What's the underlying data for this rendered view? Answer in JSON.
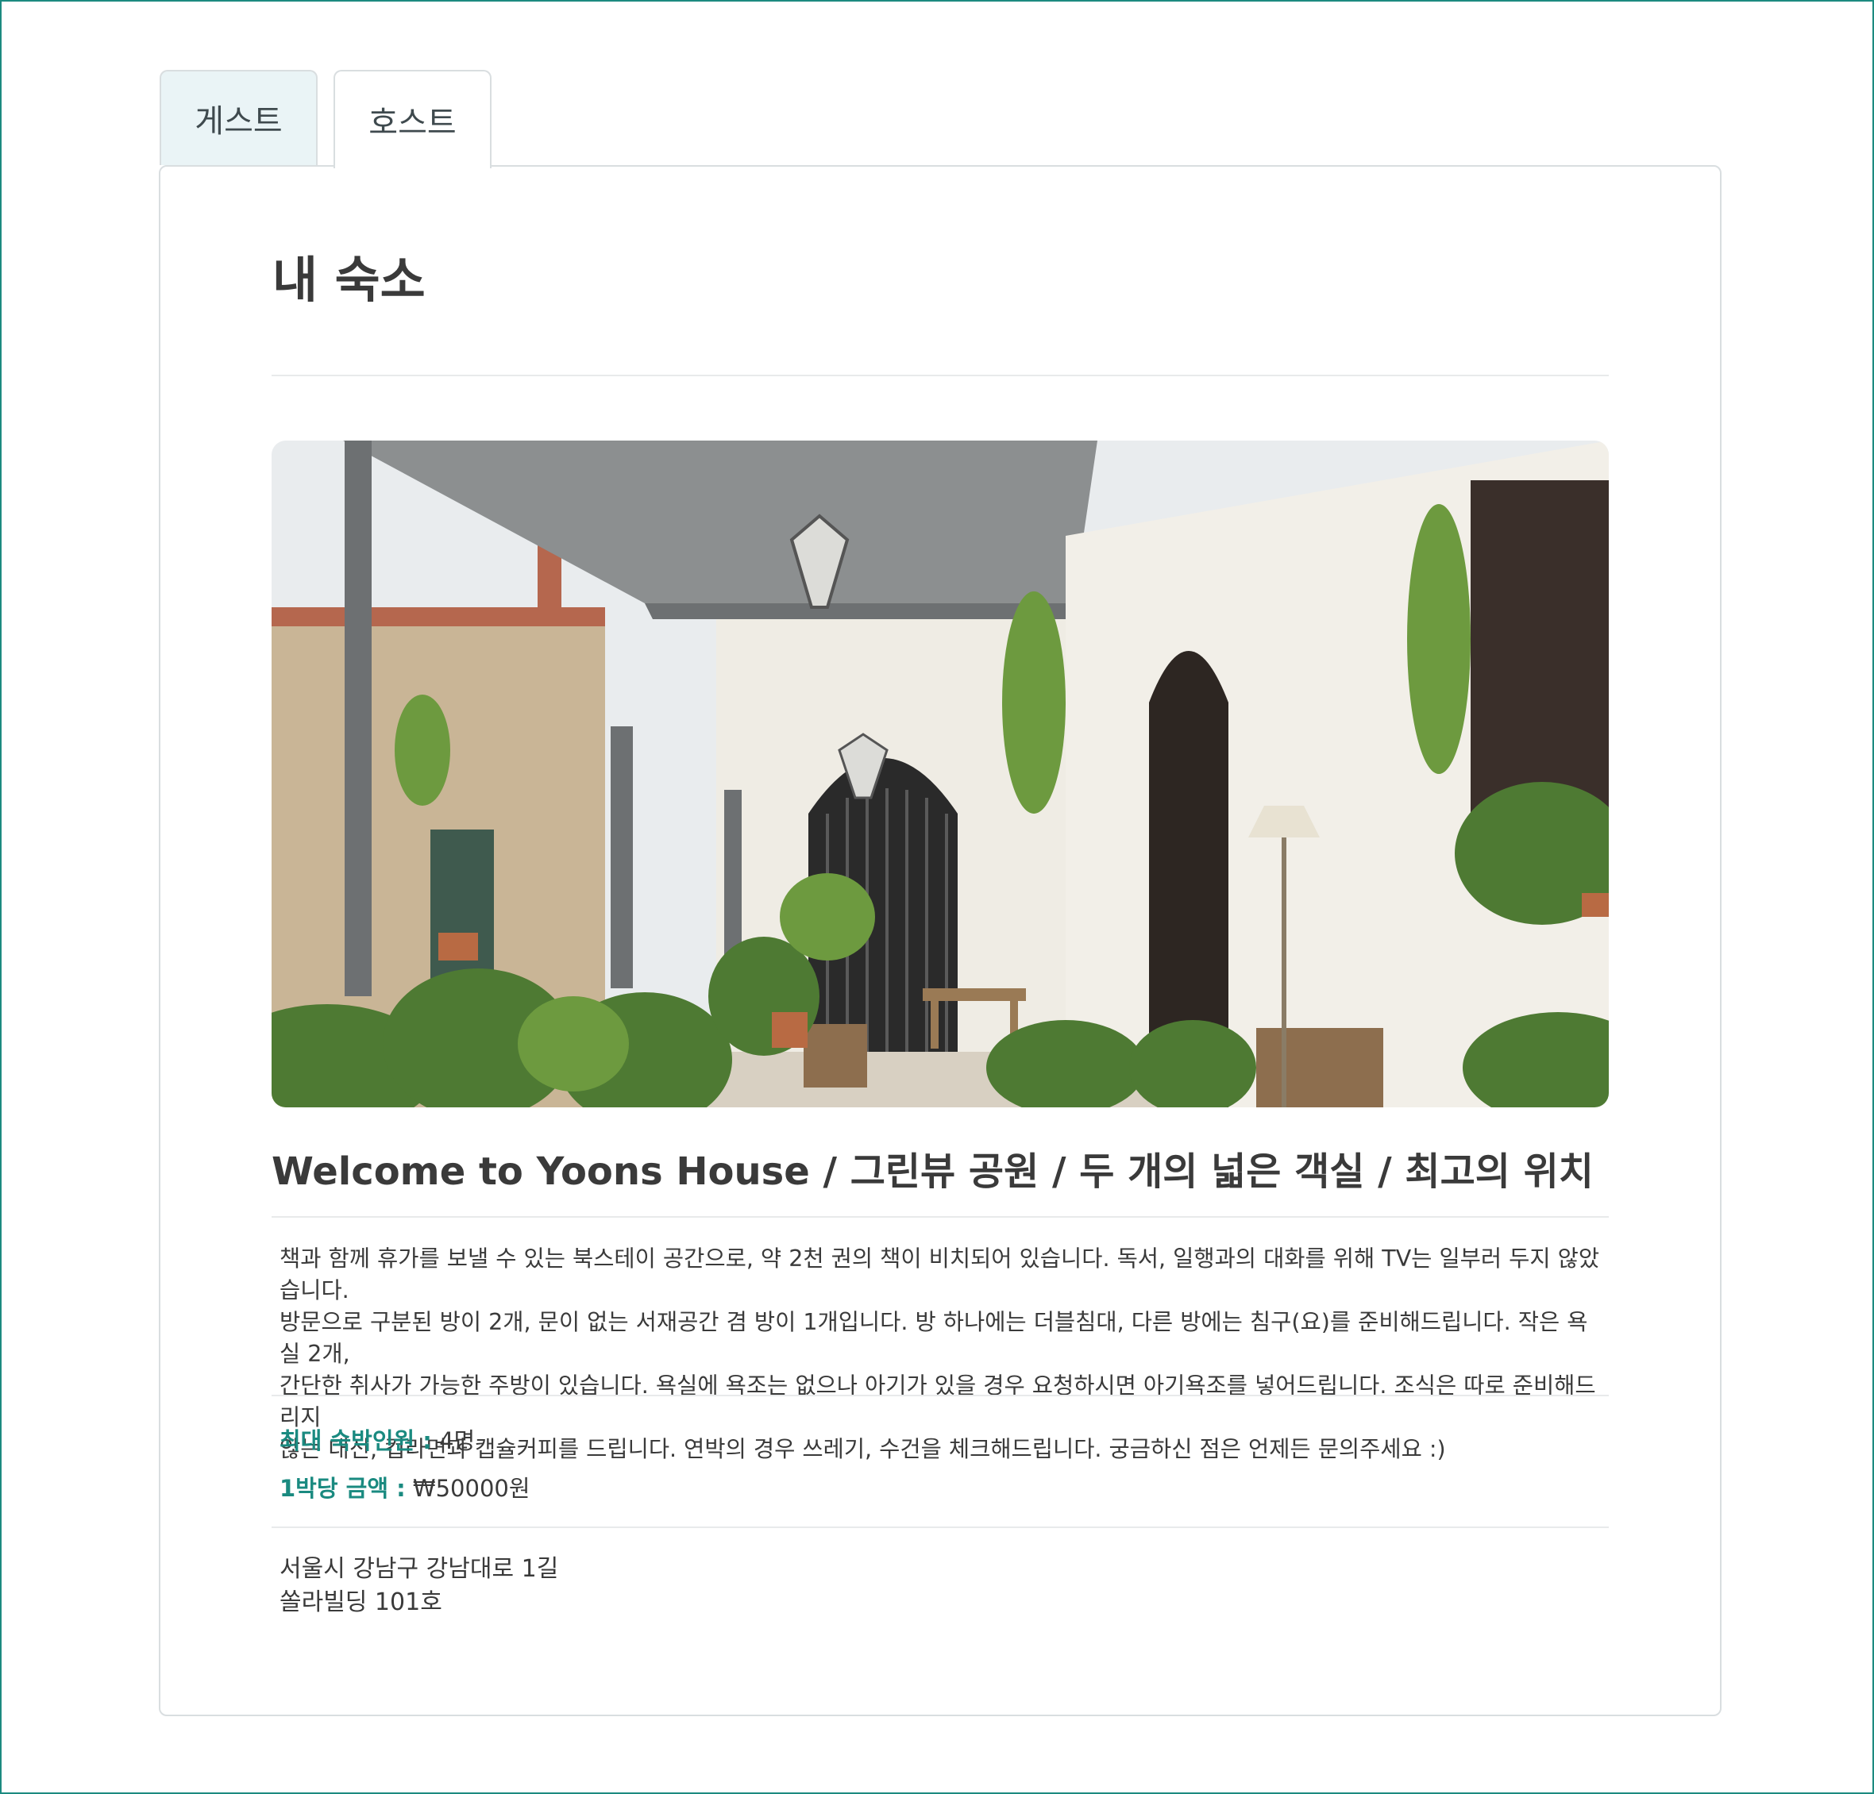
{
  "tabs": {
    "guest_label": "게스트",
    "host_label": "호스트",
    "active": "host"
  },
  "page": {
    "title": "내 숙소"
  },
  "listing": {
    "title": "Welcome to Yoons House / 그린뷰 공원 / 두 개의 넓은 객실 / 최고의 위치",
    "description_lines": [
      "책과 함께 휴가를 보낼 수 있는 북스테이 공간으로, 약 2천 권의 책이 비치되어 있습니다. 독서, 일행과의 대화를 위해 TV는 일부러 두지 않았습니다.",
      "방문으로 구분된 방이 2개, 문이 없는 서재공간 겸 방이 1개입니다. 방 하나에는 더블침대, 다른 방에는 침구(요)를 준비해드립니다. 작은 욕실 2개,",
      "간단한 취사가 가능한 주방이 있습니다. 욕실에 욕조는 없으나 아기가 있을 경우 요청하시면 아기욕조를 넣어드립니다. 조식은 따로 준비해드리지",
      "않는 대신, 컵라면과 캡슐커피를 드립니다. 연박의 경우 쓰레기, 수건을 체크해드립니다. 궁금하신 점은 언제든 문의주세요 :)"
    ],
    "max_guests_label": "최대 숙박인원 :",
    "max_guests_value": "4명",
    "price_label": "1박당 금액 :",
    "price_value": "₩50000원",
    "address_line1": "서울시 강남구 강남대로 1길",
    "address_line2": "쏠라빌딩 101호"
  },
  "colors": {
    "accent": "#1a8a80",
    "border": "#d9dee0",
    "guest_tab_bg": "#eaf4f6"
  }
}
